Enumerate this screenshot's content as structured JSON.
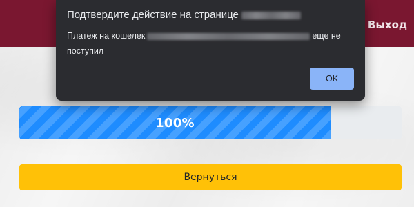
{
  "header": {
    "logout_label": "Выход",
    "background_color": "#7a1730"
  },
  "progress": {
    "value_percent": 100,
    "label": "100%",
    "fill_color": "#1e8cff",
    "track_color": "#e9ecef"
  },
  "back_button": {
    "label": "Вернуться",
    "color": "#ffc107"
  },
  "dialog": {
    "title_prefix": "Подтвердите действие на странице",
    "message_prefix": "Платеж на кошелек",
    "message_suffix": "еще не поступил",
    "ok_label": "OK",
    "background_color": "#2b2c30",
    "ok_color": "#8ab4f8"
  }
}
